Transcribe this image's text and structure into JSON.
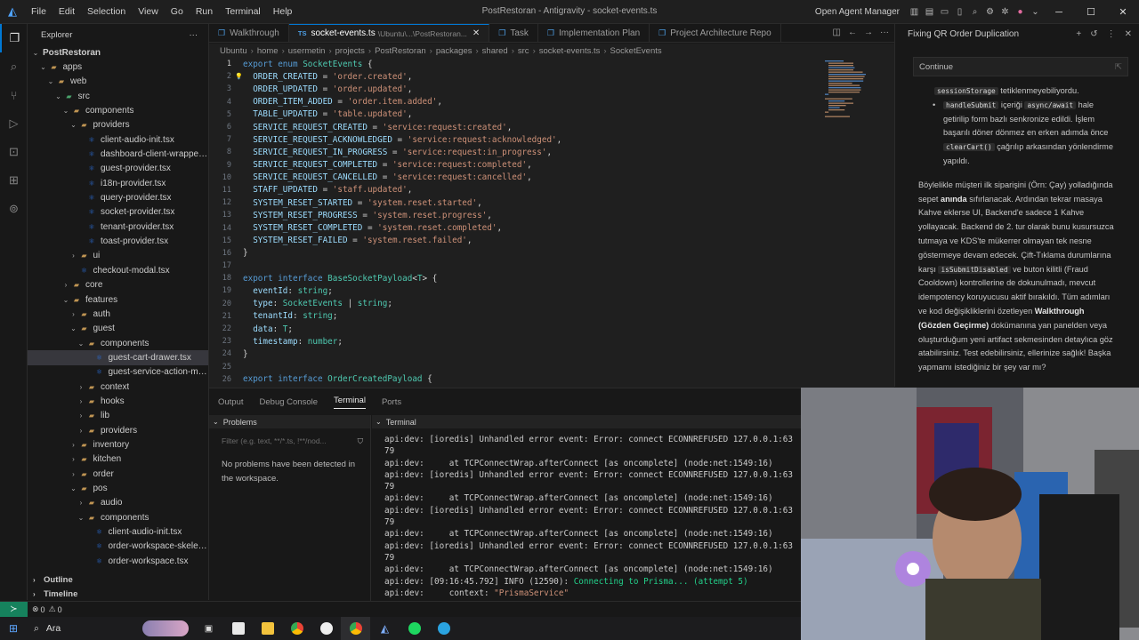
{
  "titlebar": {
    "menu": [
      "File",
      "Edit",
      "Selection",
      "View",
      "Go",
      "Run",
      "Terminal",
      "Help"
    ],
    "window_title": "PostRestoran - Antigravity - socket-events.ts",
    "open_agent_manager": "Open Agent Manager"
  },
  "explorer": {
    "title": "Explorer",
    "tree": [
      {
        "label": "PostRestoran",
        "depth": 0,
        "kind": "root"
      },
      {
        "label": "apps",
        "depth": 1,
        "kind": "folder"
      },
      {
        "label": "web",
        "depth": 2,
        "kind": "folder"
      },
      {
        "label": "src",
        "depth": 3,
        "kind": "folder-s"
      },
      {
        "label": "components",
        "depth": 4,
        "kind": "folder"
      },
      {
        "label": "providers",
        "depth": 5,
        "kind": "folder"
      },
      {
        "label": "client-audio-init.tsx",
        "depth": 6,
        "kind": "tsx"
      },
      {
        "label": "dashboard-client-wrapper.tsx",
        "depth": 6,
        "kind": "tsx"
      },
      {
        "label": "guest-provider.tsx",
        "depth": 6,
        "kind": "tsx"
      },
      {
        "label": "i18n-provider.tsx",
        "depth": 6,
        "kind": "tsx"
      },
      {
        "label": "query-provider.tsx",
        "depth": 6,
        "kind": "tsx"
      },
      {
        "label": "socket-provider.tsx",
        "depth": 6,
        "kind": "tsx"
      },
      {
        "label": "tenant-provider.tsx",
        "depth": 6,
        "kind": "tsx"
      },
      {
        "label": "toast-provider.tsx",
        "depth": 6,
        "kind": "tsx"
      },
      {
        "label": "ui",
        "depth": 5,
        "kind": "folder-c"
      },
      {
        "label": "checkout-modal.tsx",
        "depth": 5,
        "kind": "tsx"
      },
      {
        "label": "core",
        "depth": 4,
        "kind": "folder-c"
      },
      {
        "label": "features",
        "depth": 4,
        "kind": "folder"
      },
      {
        "label": "auth",
        "depth": 5,
        "kind": "folder-c"
      },
      {
        "label": "guest",
        "depth": 5,
        "kind": "folder"
      },
      {
        "label": "components",
        "depth": 6,
        "kind": "folder"
      },
      {
        "label": "guest-cart-drawer.tsx",
        "depth": 7,
        "kind": "tsx",
        "selected": true
      },
      {
        "label": "guest-service-action-menu.t...",
        "depth": 7,
        "kind": "tsx"
      },
      {
        "label": "context",
        "depth": 6,
        "kind": "folder-c"
      },
      {
        "label": "hooks",
        "depth": 6,
        "kind": "folder-c"
      },
      {
        "label": "lib",
        "depth": 6,
        "kind": "folder-c"
      },
      {
        "label": "providers",
        "depth": 6,
        "kind": "folder-c"
      },
      {
        "label": "inventory",
        "depth": 5,
        "kind": "folder-c"
      },
      {
        "label": "kitchen",
        "depth": 5,
        "kind": "folder-c"
      },
      {
        "label": "order",
        "depth": 5,
        "kind": "folder-c"
      },
      {
        "label": "pos",
        "depth": 5,
        "kind": "folder"
      },
      {
        "label": "audio",
        "depth": 6,
        "kind": "folder-c"
      },
      {
        "label": "components",
        "depth": 6,
        "kind": "folder"
      },
      {
        "label": "client-audio-init.tsx",
        "depth": 7,
        "kind": "tsx"
      },
      {
        "label": "order-workspace-skeleton.tsx",
        "depth": 7,
        "kind": "tsx"
      },
      {
        "label": "order-workspace.tsx",
        "depth": 7,
        "kind": "tsx"
      }
    ],
    "outline": "Outline",
    "timeline": "Timeline"
  },
  "tabs": [
    {
      "label": "Walkthrough",
      "icon": "document-icon"
    },
    {
      "label": "socket-events.ts",
      "sub": "\\Ubuntu\\...\\PostRestoran...",
      "icon": "ts-icon",
      "active": true
    },
    {
      "label": "Task",
      "icon": "document-icon"
    },
    {
      "label": "Implementation Plan",
      "icon": "document-icon"
    },
    {
      "label": "Project Architecture Repo",
      "icon": "document-icon"
    }
  ],
  "breadcrumb": [
    "Ubuntu",
    "home",
    "usermetin",
    "projects",
    "PostRestoran",
    "packages",
    "shared",
    "src",
    "socket-events.ts",
    "SocketEvents"
  ],
  "editor": {
    "lines": [
      [
        [
          "kw",
          "export "
        ],
        [
          "kw",
          "enum "
        ],
        [
          "ty",
          "SocketEvents "
        ],
        [
          "pu",
          "{"
        ]
      ],
      [
        [
          "pu",
          "  "
        ],
        [
          "pr",
          "ORDER_CREATED"
        ],
        [
          "pu",
          " = "
        ],
        [
          "st",
          "'order.created'"
        ],
        [
          "pu",
          ","
        ]
      ],
      [
        [
          "pu",
          "  "
        ],
        [
          "pr",
          "ORDER_UPDATED"
        ],
        [
          "pu",
          " = "
        ],
        [
          "st",
          "'order.updated'"
        ],
        [
          "pu",
          ","
        ]
      ],
      [
        [
          "pu",
          "  "
        ],
        [
          "pr",
          "ORDER_ITEM_ADDED"
        ],
        [
          "pu",
          " = "
        ],
        [
          "st",
          "'order.item.added'"
        ],
        [
          "pu",
          ","
        ]
      ],
      [
        [
          "pu",
          "  "
        ],
        [
          "pr",
          "TABLE_UPDATED"
        ],
        [
          "pu",
          " = "
        ],
        [
          "st",
          "'table.updated'"
        ],
        [
          "pu",
          ","
        ]
      ],
      [
        [
          "pu",
          "  "
        ],
        [
          "pr",
          "SERVICE_REQUEST_CREATED"
        ],
        [
          "pu",
          " = "
        ],
        [
          "st",
          "'service:request:created'"
        ],
        [
          "pu",
          ","
        ]
      ],
      [
        [
          "pu",
          "  "
        ],
        [
          "pr",
          "SERVICE_REQUEST_ACKNOWLEDGED"
        ],
        [
          "pu",
          " = "
        ],
        [
          "st",
          "'service:request:acknowledged'"
        ],
        [
          "pu",
          ","
        ]
      ],
      [
        [
          "pu",
          "  "
        ],
        [
          "pr",
          "SERVICE_REQUEST_IN_PROGRESS"
        ],
        [
          "pu",
          " = "
        ],
        [
          "st",
          "'service:request:in_progress'"
        ],
        [
          "pu",
          ","
        ]
      ],
      [
        [
          "pu",
          "  "
        ],
        [
          "pr",
          "SERVICE_REQUEST_COMPLETED"
        ],
        [
          "pu",
          " = "
        ],
        [
          "st",
          "'service:request:completed'"
        ],
        [
          "pu",
          ","
        ]
      ],
      [
        [
          "pu",
          "  "
        ],
        [
          "pr",
          "SERVICE_REQUEST_CANCELLED"
        ],
        [
          "pu",
          " = "
        ],
        [
          "st",
          "'service:request:cancelled'"
        ],
        [
          "pu",
          ","
        ]
      ],
      [
        [
          "pu",
          "  "
        ],
        [
          "pr",
          "STAFF_UPDATED"
        ],
        [
          "pu",
          " = "
        ],
        [
          "st",
          "'staff.updated'"
        ],
        [
          "pu",
          ","
        ]
      ],
      [
        [
          "pu",
          "  "
        ],
        [
          "pr",
          "SYSTEM_RESET_STARTED"
        ],
        [
          "pu",
          " = "
        ],
        [
          "st",
          "'system.reset.started'"
        ],
        [
          "pu",
          ","
        ]
      ],
      [
        [
          "pu",
          "  "
        ],
        [
          "pr",
          "SYSTEM_RESET_PROGRESS"
        ],
        [
          "pu",
          " = "
        ],
        [
          "st",
          "'system.reset.progress'"
        ],
        [
          "pu",
          ","
        ]
      ],
      [
        [
          "pu",
          "  "
        ],
        [
          "pr",
          "SYSTEM_RESET_COMPLETED"
        ],
        [
          "pu",
          " = "
        ],
        [
          "st",
          "'system.reset.completed'"
        ],
        [
          "pu",
          ","
        ]
      ],
      [
        [
          "pu",
          "  "
        ],
        [
          "pr",
          "SYSTEM_RESET_FAILED"
        ],
        [
          "pu",
          " = "
        ],
        [
          "st",
          "'system.reset.failed'"
        ],
        [
          "pu",
          ","
        ]
      ],
      [
        [
          "pu",
          "}"
        ]
      ],
      [],
      [
        [
          "kw",
          "export "
        ],
        [
          "kw",
          "interface "
        ],
        [
          "ty",
          "BaseSocketPayload"
        ],
        [
          "pu",
          "<"
        ],
        [
          "ty",
          "T"
        ],
        [
          "pu",
          "> {"
        ]
      ],
      [
        [
          "pu",
          "  "
        ],
        [
          "pr",
          "eventId"
        ],
        [
          "pu",
          ": "
        ],
        [
          "ty",
          "string"
        ],
        [
          "pu",
          ";"
        ]
      ],
      [
        [
          "pu",
          "  "
        ],
        [
          "pr",
          "type"
        ],
        [
          "pu",
          ": "
        ],
        [
          "ty",
          "SocketEvents"
        ],
        [
          "pu",
          " | "
        ],
        [
          "ty",
          "string"
        ],
        [
          "pu",
          ";"
        ]
      ],
      [
        [
          "pu",
          "  "
        ],
        [
          "pr",
          "tenantId"
        ],
        [
          "pu",
          ": "
        ],
        [
          "ty",
          "string"
        ],
        [
          "pu",
          ";"
        ]
      ],
      [
        [
          "pu",
          "  "
        ],
        [
          "pr",
          "data"
        ],
        [
          "pu",
          ": "
        ],
        [
          "ty",
          "T"
        ],
        [
          "pu",
          ";"
        ]
      ],
      [
        [
          "pu",
          "  "
        ],
        [
          "pr",
          "timestamp"
        ],
        [
          "pu",
          ": "
        ],
        [
          "ty",
          "number"
        ],
        [
          "pu",
          ";"
        ]
      ],
      [
        [
          "pu",
          "}"
        ]
      ],
      [],
      [
        [
          "kw",
          "export "
        ],
        [
          "kw",
          "interface "
        ],
        [
          "ty",
          "OrderCreatedPayload "
        ],
        [
          "pu",
          "{"
        ]
      ]
    ]
  },
  "panel": {
    "tabs": [
      "Output",
      "Debug Console",
      "Terminal",
      "Ports"
    ],
    "active_tab": "Terminal",
    "problems_title": "Problems",
    "filter_placeholder": "Filter (e.g. text, **/*.ts, !**/nod...",
    "no_problems": "No problems have been detected in the workspace.",
    "terminal_title": "Terminal",
    "terminal_lines": [
      {
        "p": "api:dev: ",
        "t": "[ioredis] Unhandled error event: Error: connect ECONNREFUSED 127.0.0.1:63"
      },
      {
        "p": "",
        "t": "79"
      },
      {
        "p": "api:dev: ",
        "t": "    at TCPConnectWrap.afterConnect [as oncomplete] (node:net:1549:16)"
      },
      {
        "p": "api:dev: ",
        "t": "[ioredis] Unhandled error event: Error: connect ECONNREFUSED 127.0.0.1:63"
      },
      {
        "p": "",
        "t": "79"
      },
      {
        "p": "api:dev: ",
        "t": "    at TCPConnectWrap.afterConnect [as oncomplete] (node:net:1549:16)"
      },
      {
        "p": "api:dev: ",
        "t": "[ioredis] Unhandled error event: Error: connect ECONNREFUSED 127.0.0.1:63"
      },
      {
        "p": "",
        "t": "79"
      },
      {
        "p": "api:dev: ",
        "t": "    at TCPConnectWrap.afterConnect [as oncomplete] (node:net:1549:16)"
      },
      {
        "p": "api:dev: ",
        "t": "[ioredis] Unhandled error event: Error: connect ECONNREFUSED 127.0.0.1:63"
      },
      {
        "p": "",
        "t": "79"
      },
      {
        "p": "api:dev: ",
        "t": "    at TCPConnectWrap.afterConnect [as oncomplete] (node:net:1549:16)"
      },
      {
        "p": "api:dev: ",
        "t": "[09:16:45.792] INFO (12590): ",
        "g": "Connecting to Prisma... (attempt 5)"
      },
      {
        "p": "api:dev: ",
        "t": "    context: ",
        "s": "\"PrismaService\""
      }
    ]
  },
  "rightpanel": {
    "title": "Fixing QR Order Duplication",
    "continue": "Continue",
    "top_code": "sessionStorage",
    "top_text": " tetiklenmeyebiliyordu.",
    "bullet_code1": "handleSubmit",
    "bullet_mid": " içeriği ",
    "bullet_code2": "async/await",
    "bullet_text": " hale getirilip form bazlı senkronize edildi. İşlem başarılı döner dönmez en erken adımda önce ",
    "bullet_code3": "clearCart()",
    "bullet_end": " çağrılıp arkasından yönlendirme yapıldı.",
    "para1": "Böylelikle müşteri ilk siparişini (Örn: Çay) yolladığında sepet ",
    "para1_bold": "anında",
    "para2": " sıfırlanacak. Ardından tekrar masaya Kahve eklerse UI, Backend'e sadece 1 Kahve yollayacak. Backend de 2. tur olarak bunu kusursuzca tutmaya ve KDS'te mükerrer olmayan tek nesne göstermeye devam edecek. Çift-Tıklama durumlarına karşı ",
    "para_code": "isSubmitDisabled",
    "para3": " ve buton kilitli (Fraud Cooldown) kontrollerine de dokunulmadı, mevcut idempotency koruyucusu aktif bırakıldı. Tüm adımları ve kod değişikliklerini özetleyen ",
    "para3_bold": "Walkthrough (Gözden Geçirme)",
    "para4": " dokümanına yan panelden veya oluşturduğum yeni artifact sekmesinden detaylıca göz atabilirsiniz. Test edebilirsiniz, ellerinize sağlık! Başka yapmamı istediğiniz bir şey var mı?"
  },
  "statusbar": {
    "errors": "0",
    "warnings": "0"
  },
  "taskbar": {
    "search": "Ara"
  },
  "colors": {
    "accent": "#0078d4",
    "remote": "#16825d",
    "keyword": "#569cd6",
    "string": "#ce9178",
    "type": "#4ec9b0",
    "property": "#9cdcfe"
  }
}
